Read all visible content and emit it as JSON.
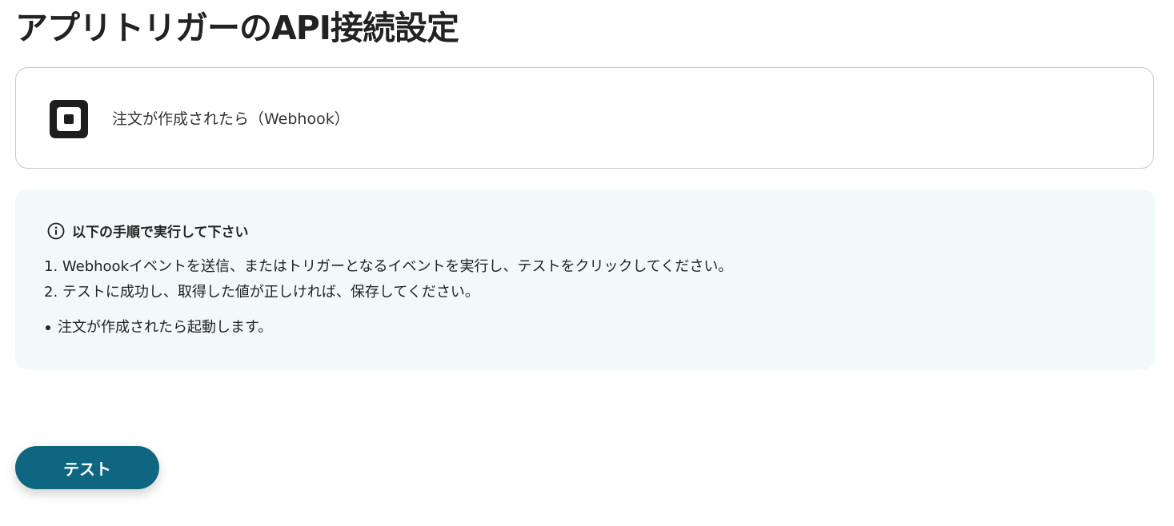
{
  "page": {
    "title": "アプリトリガーのAPI接続設定"
  },
  "trigger": {
    "icon": "square-app-icon",
    "label": "注文が作成されたら（Webhook）"
  },
  "instructions": {
    "icon": "info-circle-icon",
    "heading": "以下の手順で実行して下さい",
    "steps": [
      "1. Webhookイベントを送信、またはトリガーとなるイベントを実行し、テストをクリックしてください。",
      "2. テストに成功し、取得した値が正しければ、保存してください。"
    ],
    "notes": [
      "注文が作成されたら起動します。"
    ]
  },
  "actions": {
    "test_label": "テスト"
  },
  "colors": {
    "accent": "#0e6680",
    "info_background": "#f1f9f9",
    "card_border": "#c8c8c8"
  }
}
